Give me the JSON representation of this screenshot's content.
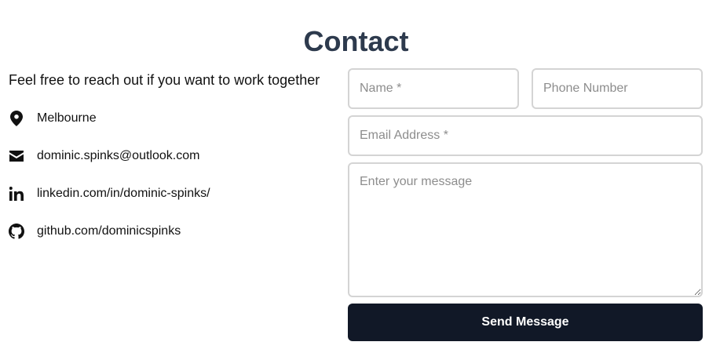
{
  "page": {
    "title": "Contact"
  },
  "contact_info": {
    "intro": "Feel free to reach out if you want to work together",
    "items": [
      {
        "icon": "location-pin-icon",
        "text": "Melbourne"
      },
      {
        "icon": "mail-icon",
        "text": "dominic.spinks@outlook.com"
      },
      {
        "icon": "linkedin-icon",
        "text": "linkedin.com/in/dominic-spinks/"
      },
      {
        "icon": "github-icon",
        "text": "github.com/dominicspinks"
      }
    ]
  },
  "form": {
    "name_placeholder": "Name *",
    "phone_placeholder": "Phone Number",
    "email_placeholder": "Email Address *",
    "message_placeholder": "Enter your message",
    "submit_label": "Send Message"
  },
  "colors": {
    "title": "#2d3a4d",
    "button_bg": "#111827",
    "field_border": "#d4d4d4",
    "placeholder": "#8d8d8d"
  }
}
